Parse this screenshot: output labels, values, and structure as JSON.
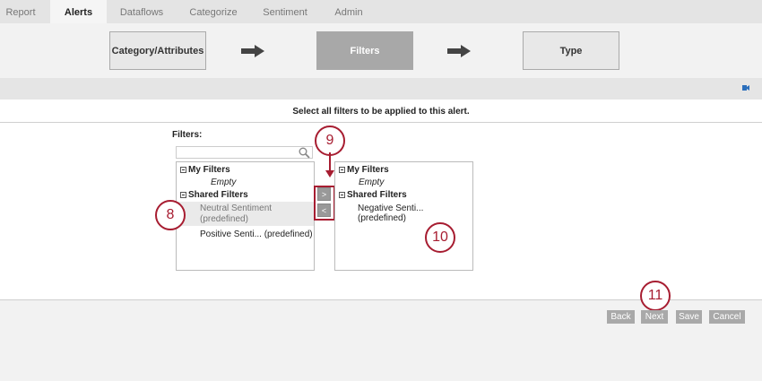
{
  "tabs": [
    {
      "label": "Report",
      "active": false
    },
    {
      "label": "Alerts",
      "active": true
    },
    {
      "label": "Dataflows",
      "active": false
    },
    {
      "label": "Categorize",
      "active": false
    },
    {
      "label": "Sentiment",
      "active": false
    },
    {
      "label": "Admin",
      "active": false
    }
  ],
  "steps": {
    "step1": "Category/Attributes",
    "step2": "Filters",
    "step3": "Type",
    "active": "Filters"
  },
  "instruction": "Select all filters to be applied to this alert.",
  "filters_label": "Filters:",
  "search": {
    "value": "",
    "placeholder": ""
  },
  "available": {
    "my_filters": "My Filters",
    "my_filters_empty": "Empty",
    "shared_filters": "Shared Filters",
    "items": [
      {
        "line1": "Neutral Sentiment",
        "line2": "(predefined)",
        "selected": true
      },
      {
        "line1": "Positive Senti... (predefined)",
        "selected": false
      }
    ]
  },
  "selected": {
    "my_filters": "My Filters",
    "my_filters_empty": "Empty",
    "shared_filters": "Shared Filters",
    "items": [
      {
        "line1": "Negative Senti... (predefined)"
      }
    ]
  },
  "move_buttons": {
    "add": ">",
    "remove": "<"
  },
  "callouts": {
    "c8": "8",
    "c9": "9",
    "c10": "10",
    "c11": "11"
  },
  "buttons": {
    "back": "Back",
    "next": "Next",
    "save": "Save",
    "cancel": "Cancel"
  },
  "colors": {
    "callout": "#a71d31",
    "button": "#a9a9a9",
    "active_step": "#a8a8a8"
  },
  "icons": {
    "step_arrow": "right-arrow-icon",
    "search": "magnifier-icon",
    "video": "video-camera-icon",
    "tree_toggle": "minus-box-icon"
  }
}
